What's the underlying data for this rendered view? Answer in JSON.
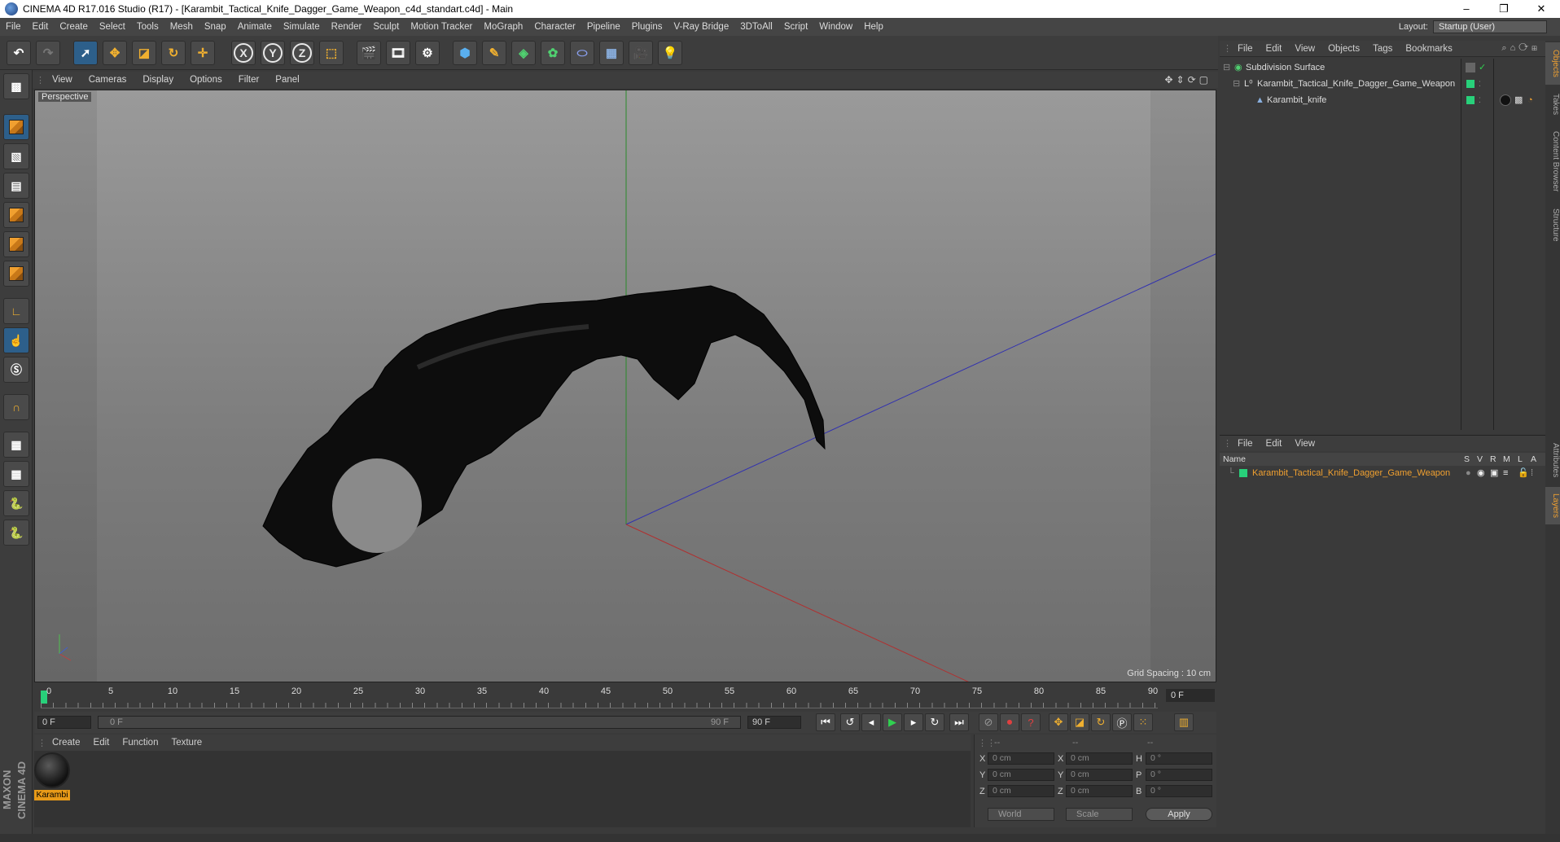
{
  "window": {
    "title": "CINEMA 4D R17.016 Studio (R17) - [Karambit_Tactical_Knife_Dagger_Game_Weapon_c4d_standart.c4d] - Main",
    "minimize": "–",
    "restore": "❐",
    "close": "✕"
  },
  "menubar": {
    "items": [
      "File",
      "Edit",
      "Create",
      "Select",
      "Tools",
      "Mesh",
      "Snap",
      "Animate",
      "Simulate",
      "Render",
      "Sculpt",
      "Motion Tracker",
      "MoGraph",
      "Character",
      "Pipeline",
      "Plugins",
      "V-Ray Bridge",
      "3DToAll",
      "Script",
      "Window",
      "Help"
    ],
    "layout_label": "Layout:",
    "layout_value": "Startup (User)"
  },
  "toolbar": {
    "axis_x": "X",
    "axis_y": "Y",
    "axis_z": "Z"
  },
  "viewport": {
    "menu": [
      "View",
      "Cameras",
      "Display",
      "Options",
      "Filter",
      "Panel"
    ],
    "camera_label": "Perspective",
    "grid_spacing": "Grid Spacing : 10 cm"
  },
  "timeline": {
    "ticks": [
      "0",
      "5",
      "10",
      "15",
      "20",
      "25",
      "30",
      "35",
      "40",
      "45",
      "50",
      "55",
      "60",
      "65",
      "70",
      "75",
      "80",
      "85",
      "90"
    ],
    "current_frame_field": "0 F"
  },
  "transport": {
    "start_field": "0 F",
    "range_start": "0 F",
    "range_end": "90 F",
    "end_field": "90 F"
  },
  "materials": {
    "menu": [
      "Create",
      "Edit",
      "Function",
      "Texture"
    ],
    "items": [
      {
        "label": "Karambi"
      }
    ]
  },
  "coordinates": {
    "header": [
      "--",
      "--",
      "--"
    ],
    "rows": [
      {
        "pos_label": "X",
        "pos_value": "0 cm",
        "size_label": "X",
        "size_value": "0 cm",
        "rot_label": "H",
        "rot_value": "0 °"
      },
      {
        "pos_label": "Y",
        "pos_value": "0 cm",
        "size_label": "Y",
        "size_value": "0 cm",
        "rot_label": "P",
        "rot_value": "0 °"
      },
      {
        "pos_label": "Z",
        "pos_value": "0 cm",
        "size_label": "Z",
        "size_value": "0 cm",
        "rot_label": "B",
        "rot_value": "0 °"
      }
    ],
    "space_dropdown": "World",
    "mode_dropdown": "Scale",
    "apply_label": "Apply"
  },
  "objects_panel": {
    "menu": [
      "File",
      "Edit",
      "View",
      "Objects",
      "Tags",
      "Bookmarks"
    ],
    "tree": [
      {
        "name": "Subdivision Surface",
        "depth": 0
      },
      {
        "name": "Karambit_Tactical_Knife_Dagger_Game_Weapon",
        "depth": 1
      },
      {
        "name": "Karambit_knife",
        "depth": 2
      }
    ]
  },
  "layers_panel": {
    "menu": [
      "File",
      "Edit",
      "View"
    ],
    "columns": [
      "Name",
      "S",
      "V",
      "R",
      "M",
      "L",
      "A"
    ],
    "layers": [
      {
        "name": "Karambit_Tactical_Knife_Dagger_Game_Weapon"
      }
    ]
  },
  "side_tabs": [
    "Objects",
    "Takes",
    "Content Browser",
    "Structure",
    "Attributes",
    "Layers"
  ],
  "logo": {
    "text": "MAXON CINEMA 4D"
  },
  "colors": {
    "accent_blue": "#2d5f8a",
    "layer_green": "#28d07a",
    "material_orange": "#e89a18",
    "axis_x": "#c03030",
    "axis_y": "#30a030",
    "axis_z": "#3030c0"
  }
}
